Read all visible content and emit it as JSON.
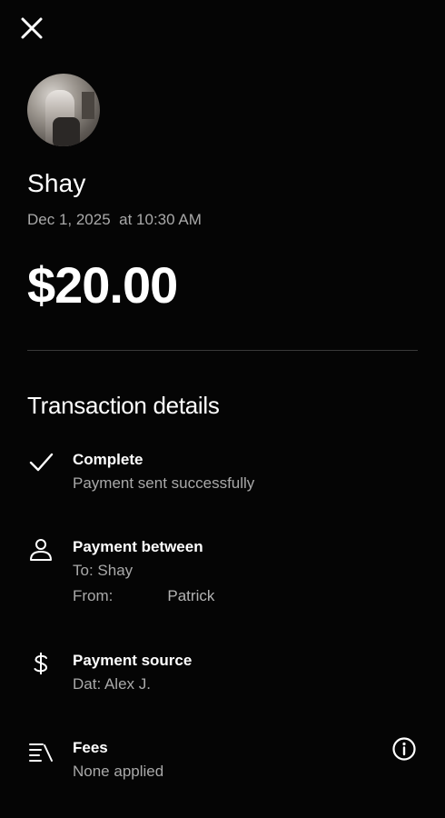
{
  "header": {
    "close_icon": "close-icon"
  },
  "recipient": {
    "name": "Shay",
    "date": "Dec 1, 2025",
    "time": "at 10:30 AM",
    "amount": "$20.00"
  },
  "details": {
    "title": "Transaction details",
    "status": {
      "icon": "checkmark-icon",
      "label": "Complete",
      "sub": "Payment sent successfully"
    },
    "between": {
      "icon": "person-icon",
      "label": "Payment between",
      "to": "To: Shay",
      "from_label": "From:",
      "from_name": "Patrick"
    },
    "source": {
      "icon": "dollar-icon",
      "label": "Payment source",
      "sub": "Dat: Alex J."
    },
    "fees": {
      "icon": "fees-icon",
      "label": "Fees",
      "sub": "None applied",
      "info_icon": "info-icon"
    }
  }
}
